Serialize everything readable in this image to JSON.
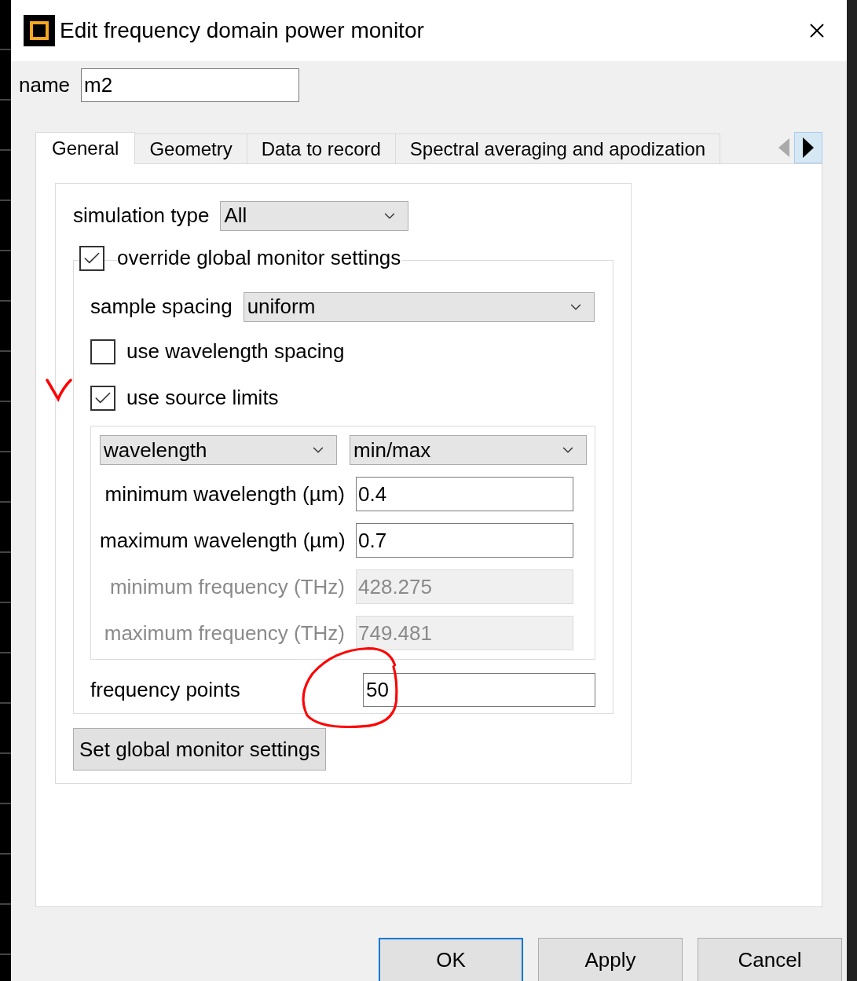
{
  "window": {
    "title": "Edit frequency domain power monitor"
  },
  "name_field": {
    "label": "name",
    "value": "m2"
  },
  "tabs": [
    {
      "label": "General",
      "selected": true
    },
    {
      "label": "Geometry",
      "selected": false
    },
    {
      "label": "Data to record",
      "selected": false
    },
    {
      "label": "Spectral averaging and apodization",
      "selected": false
    }
  ],
  "simulation_type": {
    "label": "simulation type",
    "value": "All"
  },
  "override": {
    "label": "override global monitor settings",
    "checked": true
  },
  "sample_spacing": {
    "label": "sample spacing",
    "value": "uniform"
  },
  "checkboxes": [
    {
      "label": "use wavelength spacing",
      "checked": false
    },
    {
      "label": "use source limits",
      "checked": true
    }
  ],
  "range_selectors": [
    "wavelength",
    "min/max"
  ],
  "range_fields": [
    {
      "label": "minimum wavelength (µm)",
      "value": "0.4",
      "disabled": false
    },
    {
      "label": "maximum wavelength (µm)",
      "value": "0.7",
      "disabled": false
    },
    {
      "label": "minimum frequency (THz)",
      "value": "428.275",
      "disabled": true
    },
    {
      "label": "maximum frequency (THz)",
      "value": "749.481",
      "disabled": true
    }
  ],
  "frequency_points": {
    "label": "frequency points",
    "value": "50"
  },
  "global_button": "Set global monitor settings",
  "buttons": [
    {
      "label": "OK",
      "default": true
    },
    {
      "label": "Apply",
      "default": false
    },
    {
      "label": "Cancel",
      "default": false
    }
  ]
}
